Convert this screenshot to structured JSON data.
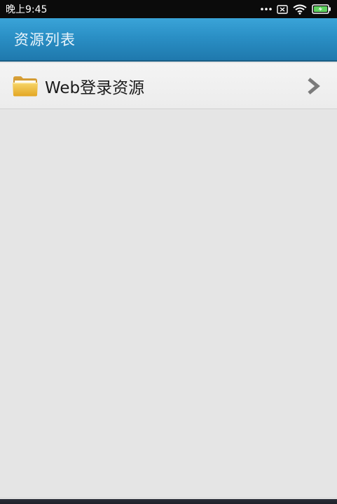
{
  "status_bar": {
    "time": "晚上9:45",
    "icons": [
      "more-dots-icon",
      "sim-card-icon",
      "wifi-icon",
      "battery-charging-icon"
    ]
  },
  "header": {
    "title": "资源列表",
    "colors": {
      "top": "#3aa4d8",
      "bottom": "#1f79ad"
    }
  },
  "resources": {
    "items": [
      {
        "label": "Web登录资源",
        "icon": "folder-icon",
        "trailing_icon": "chevron-right-icon"
      }
    ]
  }
}
